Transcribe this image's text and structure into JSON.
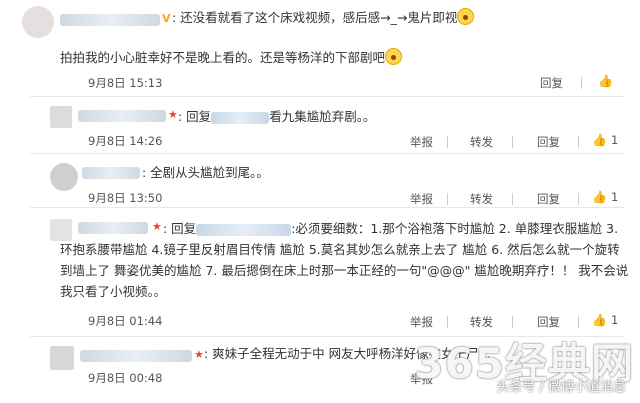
{
  "comments": [
    {
      "text_a": ": 还没看就看了这个床戏视频，感后感→_→鬼片即视",
      "text_b": "拍拍我的小心脏幸好不是晚上看的。还是等杨洋的下部剧吧",
      "time": "9月8日 15:13",
      "reply": "回复",
      "like": ""
    },
    {
      "reply_prefix": ": 回复",
      "text": "看九集尴尬弃剧。。",
      "time": "9月8日 14:26",
      "report": "举报",
      "forward": "转发",
      "reply": "回复",
      "like": "1"
    },
    {
      "text": ": 全剧从头尴尬到尾。。",
      "time": "9月8日 13:50",
      "report": "举报",
      "forward": "转发",
      "reply": "回复",
      "like": "1"
    },
    {
      "reply_prefix": ": 回复",
      "text": ":必须要细数：1.那个浴袍落下时尴尬 2. 单膝理衣服尴尬 3. 环抱系腰带尴尬 4.镜子里反射眉目传情 尴尬 5.莫名其妙怎么就亲上去了 尴尬 6. 然后怎么就一个旋转到墙上了 舞姿优美的尴尬 7. 最后摁倒在床上时那一本正经的一句\"@@@\" 尴尬晚期弃疗！！ 我不会说 我只看了小视频。。",
      "time": "9月8日 01:44",
      "report": "举报",
      "forward": "转发",
      "reply": "回复",
      "like": "1"
    },
    {
      "text": ": 爽妹子全程无动于中 网友大呼杨洋好像在女干尸...",
      "time": "9月8日 00:48",
      "report": "举报"
    }
  ],
  "watermark": "365经典网",
  "watermark_sub": "头条号 / 微博小道消息",
  "icons": [
    "avatar",
    "vip-badge-icon",
    "star-badge-icon",
    "emoji-icon",
    "thumb-up-icon"
  ]
}
